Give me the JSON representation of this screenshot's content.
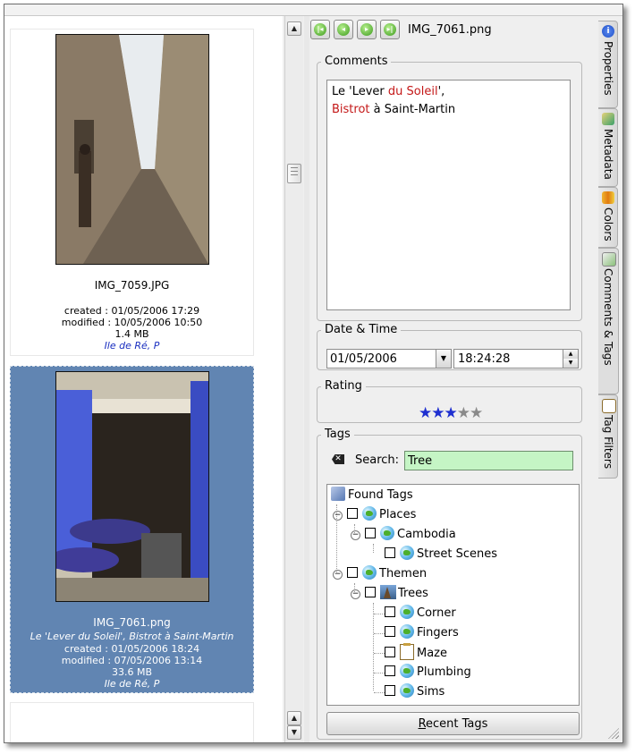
{
  "thumbnails": [
    {
      "filename": "IMG_7059.JPG",
      "caption": "",
      "created": "created : 01/05/2006 17:29",
      "modified": "modified : 10/05/2006 10:50",
      "size": "1.4 MB",
      "place": "Ile de Ré, P",
      "selected": false
    },
    {
      "filename": "IMG_7061.png",
      "caption": "Le 'Lever du Soleil', Bistrot à Saint-Martin",
      "created": "created : 01/05/2006 18:24",
      "modified": "modified : 07/05/2006 13:14",
      "size": "33.6 MB",
      "place": "Ile de Ré, P",
      "selected": true
    }
  ],
  "nav": {
    "first_icon": "first-arrow-icon",
    "prev_icon": "prev-arrow-icon",
    "next_icon": "next-arrow-icon",
    "last_icon": "last-arrow-icon",
    "current_file": "IMG_7061.png"
  },
  "comments": {
    "legend": "Comments",
    "line1_a": "Le 'Lever ",
    "line1_b": "du Soleil",
    "line1_c": "',",
    "line2_a": "Bistrot",
    "line2_b": " à Saint-Martin"
  },
  "datetime": {
    "legend": "Date & Time",
    "date": "01/05/2006",
    "time": "18:24:28"
  },
  "rating": {
    "legend": "Rating",
    "value": 3,
    "max": 5,
    "stars_on": "★★★",
    "stars_off": "★★"
  },
  "tags": {
    "legend": "Tags",
    "search_label": "Search:",
    "search_value": "Tree",
    "tree": {
      "root": "Found Tags",
      "places": "Places",
      "cambodia": "Cambodia",
      "street_scenes": "Street Scenes",
      "themen": "Themen",
      "trees": "Trees",
      "corner": "Corner",
      "fingers": "Fingers",
      "maze": "Maze",
      "plumbing": "Plumbing",
      "sims": "Sims"
    },
    "recent_button_prefix": "R",
    "recent_button_rest": "ecent Tags"
  },
  "sidetabs": [
    {
      "label": "Properties",
      "icon": "info-icon"
    },
    {
      "label": "Metadata",
      "icon": "metadata-icon"
    },
    {
      "label": "Colors",
      "icon": "colors-icon"
    },
    {
      "label": "Comments & Tags",
      "icon": "comments-tags-icon",
      "active": true
    },
    {
      "label": "Tag Filters",
      "icon": "tag-filters-icon"
    }
  ],
  "colors": {
    "selection": "#6185b2",
    "search_bg": "#c5f5c5",
    "star_on": "#1e2fd0",
    "comment_highlight": "#c41818"
  }
}
